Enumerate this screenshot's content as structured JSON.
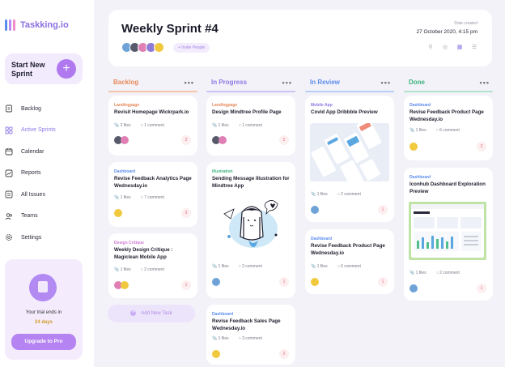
{
  "app": {
    "name": "Taskking.io"
  },
  "sidebar": {
    "start_card": {
      "label": "Start New Sprint",
      "button": "+"
    },
    "items": [
      {
        "label": "Backlog",
        "icon": "clipboard-icon",
        "active": false
      },
      {
        "label": "Active Sprints",
        "icon": "grid-icon",
        "active": true
      },
      {
        "label": "Calendar",
        "icon": "calendar-icon",
        "active": false
      },
      {
        "label": "Reports",
        "icon": "chart-icon",
        "active": false
      },
      {
        "label": "All Issues",
        "icon": "list-icon",
        "active": false
      },
      {
        "label": "Teams",
        "icon": "users-icon",
        "active": false
      },
      {
        "label": "Settings",
        "icon": "gear-icon",
        "active": false
      }
    ],
    "trial": {
      "text": "Your trial ends in",
      "days": "24 days",
      "button": "Upgrade to Pro"
    }
  },
  "header": {
    "title": "Weekly Sprint #4",
    "invite": "+ Invite People",
    "date_label": "Date created",
    "date_value": "27 October 2020, 4:15 pm"
  },
  "columns": [
    {
      "title": "Backlog",
      "color": "#e8895b"
    },
    {
      "title": "In Progress",
      "color": "#8f78e6"
    },
    {
      "title": "In Review",
      "color": "#5a8cf0"
    },
    {
      "title": "Done",
      "color": "#3fb37f"
    }
  ],
  "cards": {
    "backlog": [
      {
        "tag": "Landingpage",
        "title": "Revisit Homepage Wickrpark.io",
        "files": "2 files",
        "comments": "1 comment",
        "count": "2"
      },
      {
        "tag": "Dashboard",
        "title": "Revise Feedback Analytics Page Wednesday.io",
        "files": "1 files",
        "comments": "7 comment",
        "count": "3"
      },
      {
        "tag": "Design Critique",
        "title": "Weekly Design Critique : Magiclean Mobile App",
        "files": "1 files",
        "comments": "2 comment",
        "count": "1"
      }
    ],
    "in_progress": [
      {
        "tag": "Landingpage",
        "title": "Design Mindtree Profile Page",
        "files": "1 files",
        "comments": "1 comment",
        "count": "2"
      },
      {
        "tag": "Illustration",
        "title": "Sending Message Illustration for Mindtree App",
        "files": "1 files",
        "comments": "2 comment",
        "count": "1"
      },
      {
        "tag": "Dashboard",
        "title": "Revise Feedback Sales Page Wednesday.io",
        "files": "1 files",
        "comments": "3 comment",
        "count": "2"
      }
    ],
    "in_review": [
      {
        "tag": "Mobile App",
        "title": "Covid App Dribbble Preview",
        "files": "1 files",
        "comments": "2 comment",
        "count": "1"
      },
      {
        "tag": "Dashboard",
        "title": "Revise Feedback Product Page Wednesday.io",
        "files": "1 files",
        "comments": "6 comment",
        "count": "1"
      }
    ],
    "done": [
      {
        "tag": "Dashboard",
        "title": "Revise Feedback Product Page Wednesday.io",
        "files": "1 files",
        "comments": "6 comment",
        "count": "2"
      },
      {
        "tag": "Dashboard",
        "title": "Iconhub Dashboard Exploration Preview",
        "files": "1 files",
        "comments": "2 comment",
        "count": "1"
      }
    ]
  },
  "add_task": "Add New Task"
}
